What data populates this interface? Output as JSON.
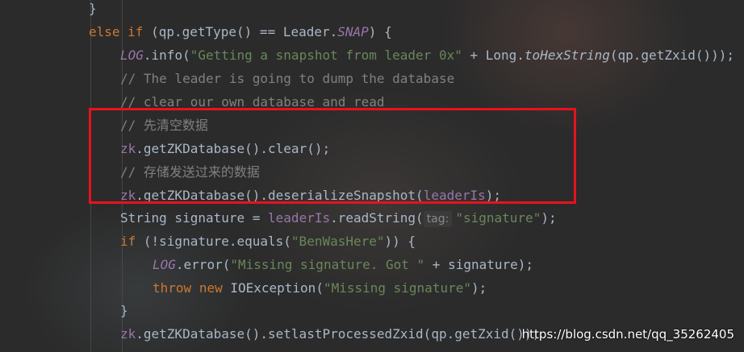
{
  "code": {
    "l0": {
      "text": "}"
    },
    "l1": {
      "kw_else": "else",
      "kw_if": "if",
      "pre": " (qp.getType() == Leader.",
      "const": "SNAP",
      "post": ") {"
    },
    "l2": {
      "const": "LOG",
      "a": ".info(",
      "str": "\"Getting a snapshot from leader 0x\"",
      "b": " + Long.",
      "static": "toHexString",
      "c": "(qp.getZxid()));"
    },
    "l3": {
      "comment": "// The leader is going to dump the database"
    },
    "l4": {
      "comment": "// clear our own database and read"
    },
    "l5": {
      "comment": "// 先清空数据"
    },
    "l6": {
      "field": "zk",
      "rest": ".getZKDatabase().clear();"
    },
    "l7": {
      "comment": "// 存储发送过来的数据"
    },
    "l8": {
      "field": "zk",
      "a": ".getZKDatabase().deserializeSnapshot(",
      "field2": "leaderIs",
      "b": ");"
    },
    "l9": {
      "a": "String signature = ",
      "field": "leaderIs",
      "b": ".readString(",
      "hint": "tag:",
      "str": "\"signature\"",
      "c": ");"
    },
    "l10": {
      "kw": "if",
      "a": " (!signature.equals(",
      "str": "\"BenWasHere\"",
      "b": ")) {"
    },
    "l11": {
      "const": "LOG",
      "a": ".error(",
      "str": "\"Missing signature. Got \"",
      "b": " + signature);"
    },
    "l12": {
      "kw_throw": "throw",
      "kw_new": "new",
      "a": " IOException(",
      "str": "\"Missing signature\"",
      "b": ");"
    },
    "l13": {
      "text": "}"
    },
    "l14": {
      "field": "zk",
      "rest": ".getZKDatabase().setlastProcessedZxid(qp.getZxid());"
    }
  },
  "watermark": "https://blog.csdn.net/qq_35262405",
  "colors": {
    "background": "#2b2b2b",
    "keyword": "#cc7832",
    "string": "#6a8759",
    "comment": "#808080",
    "field": "#9876aa",
    "text": "#a9b7c6",
    "highlight_box": "#e8121d"
  }
}
